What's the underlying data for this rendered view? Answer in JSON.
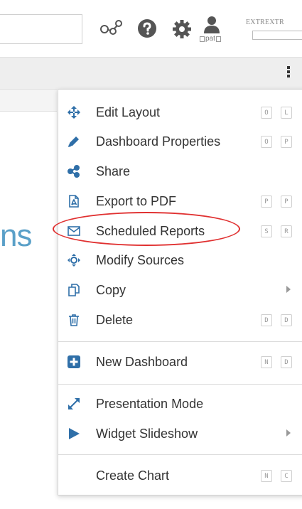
{
  "header": {
    "user_name": "pat",
    "brand_label": "EXTREXTR",
    "search_value": "",
    "brand_input_value": ""
  },
  "menu": {
    "items": [
      {
        "label": "Edit Layout",
        "icon": "move-arrows-icon",
        "keys": [
          "O",
          "L"
        ],
        "submenu": false
      },
      {
        "label": "Dashboard Properties",
        "icon": "pencil-icon",
        "keys": [
          "O",
          "P"
        ],
        "submenu": false
      },
      {
        "label": "Share",
        "icon": "share-icon",
        "keys": [],
        "submenu": false
      },
      {
        "label": "Export to PDF",
        "icon": "pdf-file-icon",
        "keys": [
          "P",
          "P"
        ],
        "submenu": false
      },
      {
        "label": "Scheduled Reports",
        "icon": "envelope-icon",
        "keys": [
          "S",
          "R"
        ],
        "submenu": false,
        "highlighted": true
      },
      {
        "label": "Modify Sources",
        "icon": "crosshair-icon",
        "keys": [],
        "submenu": false
      },
      {
        "label": "Copy",
        "icon": "copy-icon",
        "keys": [],
        "submenu": true
      },
      {
        "label": "Delete",
        "icon": "trash-icon",
        "keys": [
          "D",
          "D"
        ],
        "submenu": false
      },
      {
        "label": "New Dashboard",
        "icon": "plus-square-icon",
        "keys": [
          "N",
          "D"
        ],
        "submenu": false
      },
      {
        "label": "Presentation Mode",
        "icon": "expand-arrows-icon",
        "keys": [],
        "submenu": false
      },
      {
        "label": "Widget Slideshow",
        "icon": "play-icon",
        "keys": [],
        "submenu": true
      },
      {
        "label": "Create Chart",
        "icon": "",
        "keys": [
          "N",
          "C"
        ],
        "submenu": false
      }
    ]
  },
  "background": {
    "text_fragment": "ns"
  },
  "colors": {
    "accent_blue": "#2f6fa8",
    "highlight_red": "#e03030",
    "fragment_blue": "#5aa0c8"
  }
}
